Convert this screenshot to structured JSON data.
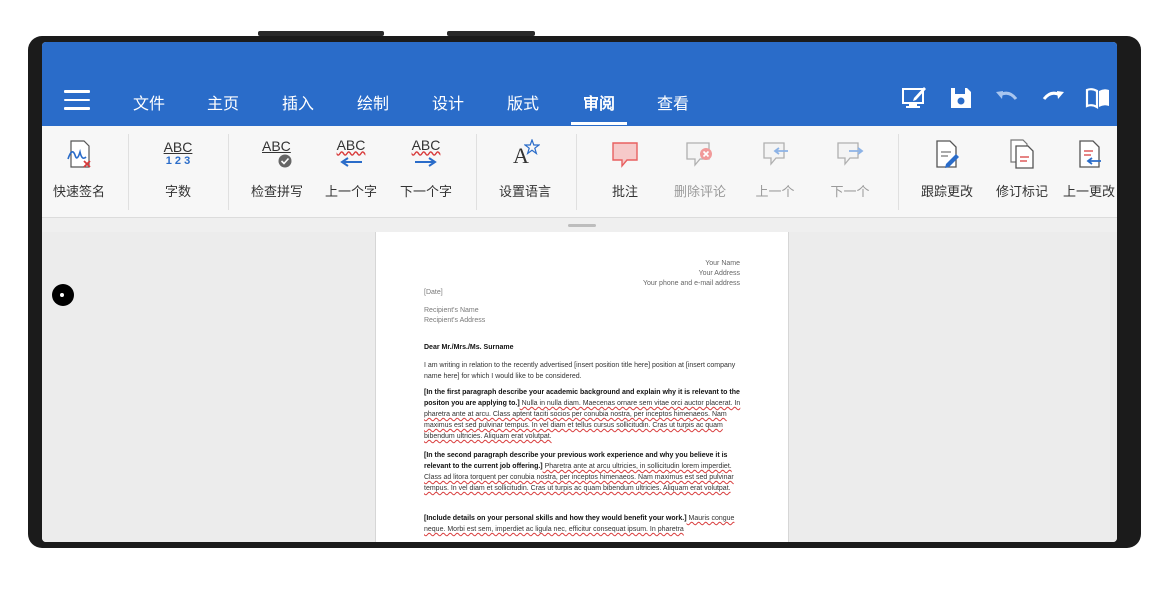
{
  "menu": {
    "items": [
      "文件",
      "主页",
      "插入",
      "绘制",
      "设计",
      "版式",
      "审阅",
      "查看"
    ],
    "active": "审阅"
  },
  "top_icons": [
    "edit-screen-icon",
    "save-icon",
    "undo-icon",
    "redo-icon",
    "read-mode-icon"
  ],
  "ribbon": {
    "quick_sign": "快速签名",
    "word_count": "字数",
    "check_spelling": "检查拼写",
    "prev_word": "上一个字",
    "next_word": "下一个字",
    "set_language": "设置语言",
    "comment": "批注",
    "delete_comment": "删除评论",
    "prev": "上一个",
    "next": "下一个",
    "track_changes": "跟踪更改",
    "revision_marks": "修订标记",
    "prev_change": "上一更改",
    "abc": "ABC",
    "digits": "1 2 3",
    "lang_glyph": "A"
  },
  "document": {
    "sender_name": "Your Name",
    "sender_address": "Your Address",
    "sender_contact": "Your phone and e-mail address",
    "date": "[Date]",
    "recipient_name": "Recipient's Name",
    "recipient_address": "Recipient's Address",
    "salutation": "Dear Mr./Mrs./Ms. Surname",
    "intro": "I am writing in relation to the recently advertised [insert position title here] position at [insert company name here] for which I would like to be considered.",
    "p1_bold": "[In the first paragraph describe your academic background and explain why it is relevant to the positon you are applying to.]",
    "p1_rest": " Nulla in nulla diam. Maecenas ornare sem vitae orci auctor placerat. In pharetra ante at arcu. Class aptent taciti socios per conubia nostra, per inceptos himenaeos. Nam maximus est sed pulvinar tempus. In vel diam et tellus cursus sollicitudin. Cras ut turpis ac quam bibendum ultricies. Aliquam erat volutpat.",
    "p2_bold": "[In the second paragraph describe your previous work experience and why you believe it is relevant to the current job offering.]",
    "p2_rest": " Pharetra ante at arcu ultricies, in sollicitudin lorem imperdiet. Class ad litora torquent per conubia nostra, per inceptos himenaeos. Nam maximus est sed pulvinar tempus. In vel diam et sollicitudin. Cras ut turpis ac quam bibendum ultricies. Aliquam erat volutpat.",
    "p3_bold": "[Include details on your personal skills and how they would benefit your work.]",
    "p3_rest": " Mauris congue neque. Morbi est sem, imperdiet ac ligula nec, efficitur consequat ipsum. In pharetra"
  },
  "colors": {
    "accent": "#2a6cc9",
    "comment_red": "#e86060"
  }
}
